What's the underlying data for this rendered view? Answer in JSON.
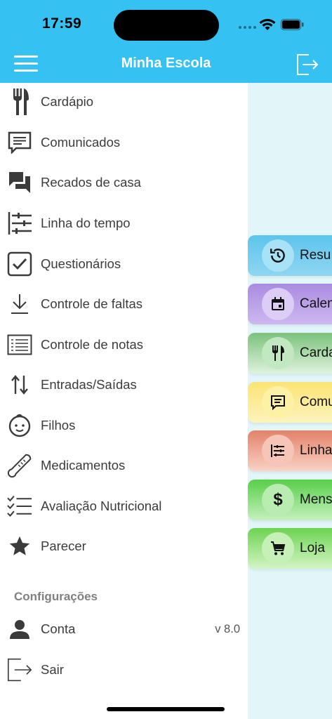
{
  "status_bar": {
    "time": "17:59"
  },
  "header": {
    "title": "Minha Escola",
    "menu_icon": "hamburger-icon",
    "logout_icon": "logout-icon"
  },
  "drawer": {
    "items": [
      {
        "label": "Cardápio",
        "icon": "fork-knife-icon"
      },
      {
        "label": "Comunicados",
        "icon": "message-icon"
      },
      {
        "label": "Recados de casa",
        "icon": "chat-bubbles-icon"
      },
      {
        "label": "Linha do tempo",
        "icon": "timeline-icon"
      },
      {
        "label": "Questionários",
        "icon": "checkbox-icon"
      },
      {
        "label": "Controle de faltas",
        "icon": "download-icon"
      },
      {
        "label": "Controle de notas",
        "icon": "list-box-icon"
      },
      {
        "label": "Entradas/Saídas",
        "icon": "swap-arrows-icon"
      },
      {
        "label": "Filhos",
        "icon": "baby-face-icon"
      },
      {
        "label": "Medicamentos",
        "icon": "thermometer-icon"
      },
      {
        "label": "Avaliação Nutricional",
        "icon": "checklist-icon"
      },
      {
        "label": "Parecer",
        "icon": "star-icon"
      }
    ],
    "section_title": "Configurações",
    "settings": [
      {
        "label": "Conta",
        "icon": "person-icon"
      },
      {
        "label": "Sair",
        "icon": "exit-icon"
      }
    ],
    "version": "v 8.0"
  },
  "cards": [
    {
      "label": "Resu",
      "icon": "history-icon",
      "color": "#5cc4ec"
    },
    {
      "label": "Calen",
      "icon": "calendar-icon",
      "color": "#b79ae6"
    },
    {
      "label": "Carda",
      "icon": "fork-knife-icon",
      "color": "#7cc27c"
    },
    {
      "label": "Comu",
      "icon": "message-icon",
      "color": "#fbe884"
    },
    {
      "label": "Linha",
      "icon": "timeline-icon",
      "color": "#e98c75"
    },
    {
      "label": "Mens",
      "icon": "dollar-icon",
      "color": "#5ed34e"
    },
    {
      "label": "Loja",
      "icon": "cart-icon",
      "color": "#6fd554"
    }
  ]
}
